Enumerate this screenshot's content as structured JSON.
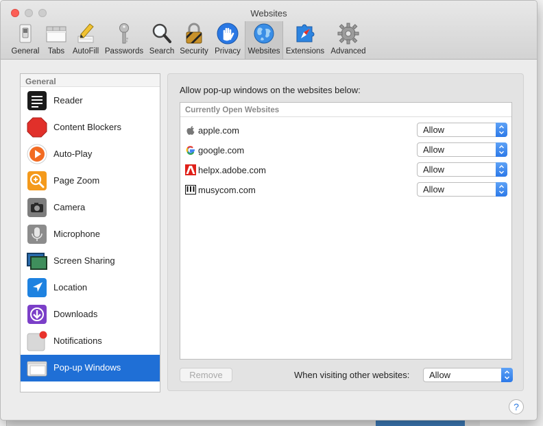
{
  "window": {
    "title": "Websites"
  },
  "toolbar": {
    "items": [
      {
        "label": "General",
        "icon": "general-switch-icon"
      },
      {
        "label": "Tabs",
        "icon": "tabs-icon"
      },
      {
        "label": "AutoFill",
        "icon": "autofill-pencil-icon"
      },
      {
        "label": "Passwords",
        "icon": "key-icon"
      },
      {
        "label": "Search",
        "icon": "magnifier-icon"
      },
      {
        "label": "Security",
        "icon": "padlock-icon"
      },
      {
        "label": "Privacy",
        "icon": "hand-icon"
      },
      {
        "label": "Websites",
        "icon": "globe-icon",
        "active": true
      },
      {
        "label": "Extensions",
        "icon": "puzzle-compass-icon"
      },
      {
        "label": "Advanced",
        "icon": "gear-icon"
      }
    ]
  },
  "sidebar": {
    "header": "General",
    "items": [
      {
        "label": "Reader",
        "icon": "reader-icon"
      },
      {
        "label": "Content Blockers",
        "icon": "stop-sign-icon"
      },
      {
        "label": "Auto-Play",
        "icon": "play-icon"
      },
      {
        "label": "Page Zoom",
        "icon": "zoom-icon"
      },
      {
        "label": "Camera",
        "icon": "camera-icon"
      },
      {
        "label": "Microphone",
        "icon": "microphone-icon"
      },
      {
        "label": "Screen Sharing",
        "icon": "screen-sharing-icon"
      },
      {
        "label": "Location",
        "icon": "location-arrow-icon"
      },
      {
        "label": "Downloads",
        "icon": "download-icon"
      },
      {
        "label": "Notifications",
        "icon": "notification-icon"
      },
      {
        "label": "Pop-up Windows",
        "icon": "popup-window-icon",
        "selected": true
      }
    ]
  },
  "main": {
    "caption": "Allow pop-up windows on the websites below:",
    "table_header": "Currently Open Websites",
    "sites": [
      {
        "name": "apple.com",
        "value": "Allow",
        "icon": "apple-favicon-icon"
      },
      {
        "name": "google.com",
        "value": "Allow",
        "icon": "google-favicon-icon"
      },
      {
        "name": "helpx.adobe.com",
        "value": "Allow",
        "icon": "adobe-favicon-icon"
      },
      {
        "name": "musycom.com",
        "value": "Allow",
        "icon": "musycom-favicon-icon"
      }
    ],
    "remove_label": "Remove",
    "other_label": "When visiting other websites:",
    "other_value": "Allow"
  },
  "help": {
    "label": "?"
  },
  "colors": {
    "accent": "#1f6fd6",
    "selection": "#1f6fd6",
    "close": "#fc5f57"
  }
}
